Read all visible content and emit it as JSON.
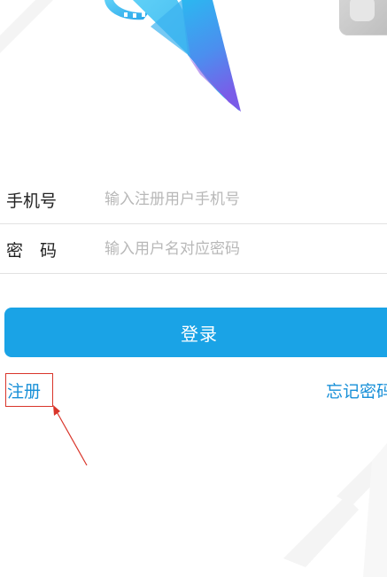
{
  "form": {
    "phone": {
      "label": "手机号",
      "placeholder": "输入注册用户手机号"
    },
    "password": {
      "label": "密　码",
      "placeholder": "输入用户名对应密码"
    }
  },
  "actions": {
    "login_label": "登录",
    "register_label": "注册",
    "forgot_label": "忘记密码"
  },
  "colors": {
    "primary": "#1aa3e6",
    "link": "#1890d8",
    "highlight_box": "#d9352a"
  },
  "icons": {
    "logo": "film-reel-logo",
    "annotation": "annotation-arrow-icon"
  }
}
